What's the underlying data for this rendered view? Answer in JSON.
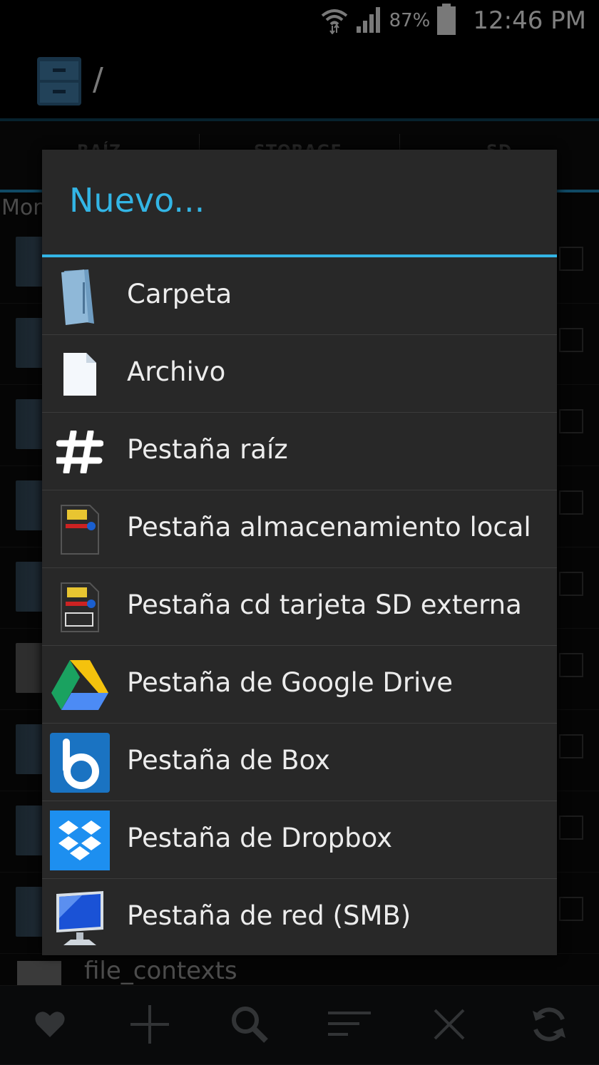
{
  "status": {
    "battery_pct": "87%",
    "time": "12:46 PM"
  },
  "header": {
    "path": "/"
  },
  "tabs": [
    "RAÍZ",
    "STORAGE",
    "SD"
  ],
  "list": {
    "heading": "Mon",
    "last_file": "file_contexts"
  },
  "dialog": {
    "title": "Nuevo...",
    "items": [
      {
        "label": "Carpeta",
        "icon": "folder-icon"
      },
      {
        "label": "Archivo",
        "icon": "file-icon"
      },
      {
        "label": "Pestaña raíz",
        "icon": "hash-icon"
      },
      {
        "label": "Pestaña almacenamiento local",
        "icon": "sd-card-icon"
      },
      {
        "label": "Pestaña cd tarjeta SD externa",
        "icon": "external-sd-icon"
      },
      {
        "label": "Pestaña de Google Drive",
        "icon": "google-drive-icon"
      },
      {
        "label": "Pestaña de Box",
        "icon": "box-icon"
      },
      {
        "label": "Pestaña de Dropbox",
        "icon": "dropbox-icon"
      },
      {
        "label": "Pestaña de red (SMB)",
        "icon": "network-monitor-icon"
      }
    ]
  },
  "colors": {
    "accent": "#33b5e5",
    "dialog_bg": "#282828"
  },
  "bottom_bar": [
    "heart-icon",
    "plus-icon",
    "search-icon",
    "sort-icon",
    "close-icon",
    "refresh-icon"
  ]
}
